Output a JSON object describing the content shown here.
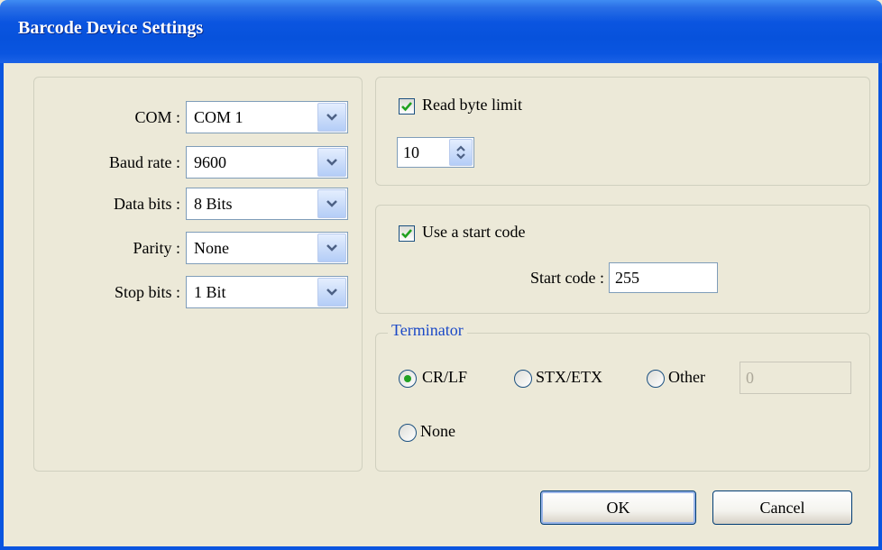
{
  "window": {
    "title": "Barcode Device Settings"
  },
  "serial": {
    "com": {
      "label": "COM :",
      "value": "COM 1"
    },
    "baud_rate": {
      "label": "Baud rate :",
      "value": "9600"
    },
    "data_bits": {
      "label": "Data bits :",
      "value": "8 Bits"
    },
    "parity": {
      "label": "Parity :",
      "value": "None"
    },
    "stop_bits": {
      "label": "Stop bits :",
      "value": "1 Bit"
    }
  },
  "read_limit": {
    "label": "Read byte limit",
    "checked": true,
    "value": "10"
  },
  "start_code": {
    "checkbox_label": "Use a start code",
    "checked": true,
    "label": "Start code :",
    "value": "255"
  },
  "terminator": {
    "legend": "Terminator",
    "options": [
      "CR/LF",
      "STX/ETX",
      "Other",
      "None"
    ],
    "selected": "CR/LF",
    "other_value": "0"
  },
  "buttons": {
    "ok": "OK",
    "cancel": "Cancel"
  },
  "colors": {
    "title_blue": "#0a55e0",
    "legend_blue": "#1b49c7",
    "check_green": "#21a121"
  }
}
